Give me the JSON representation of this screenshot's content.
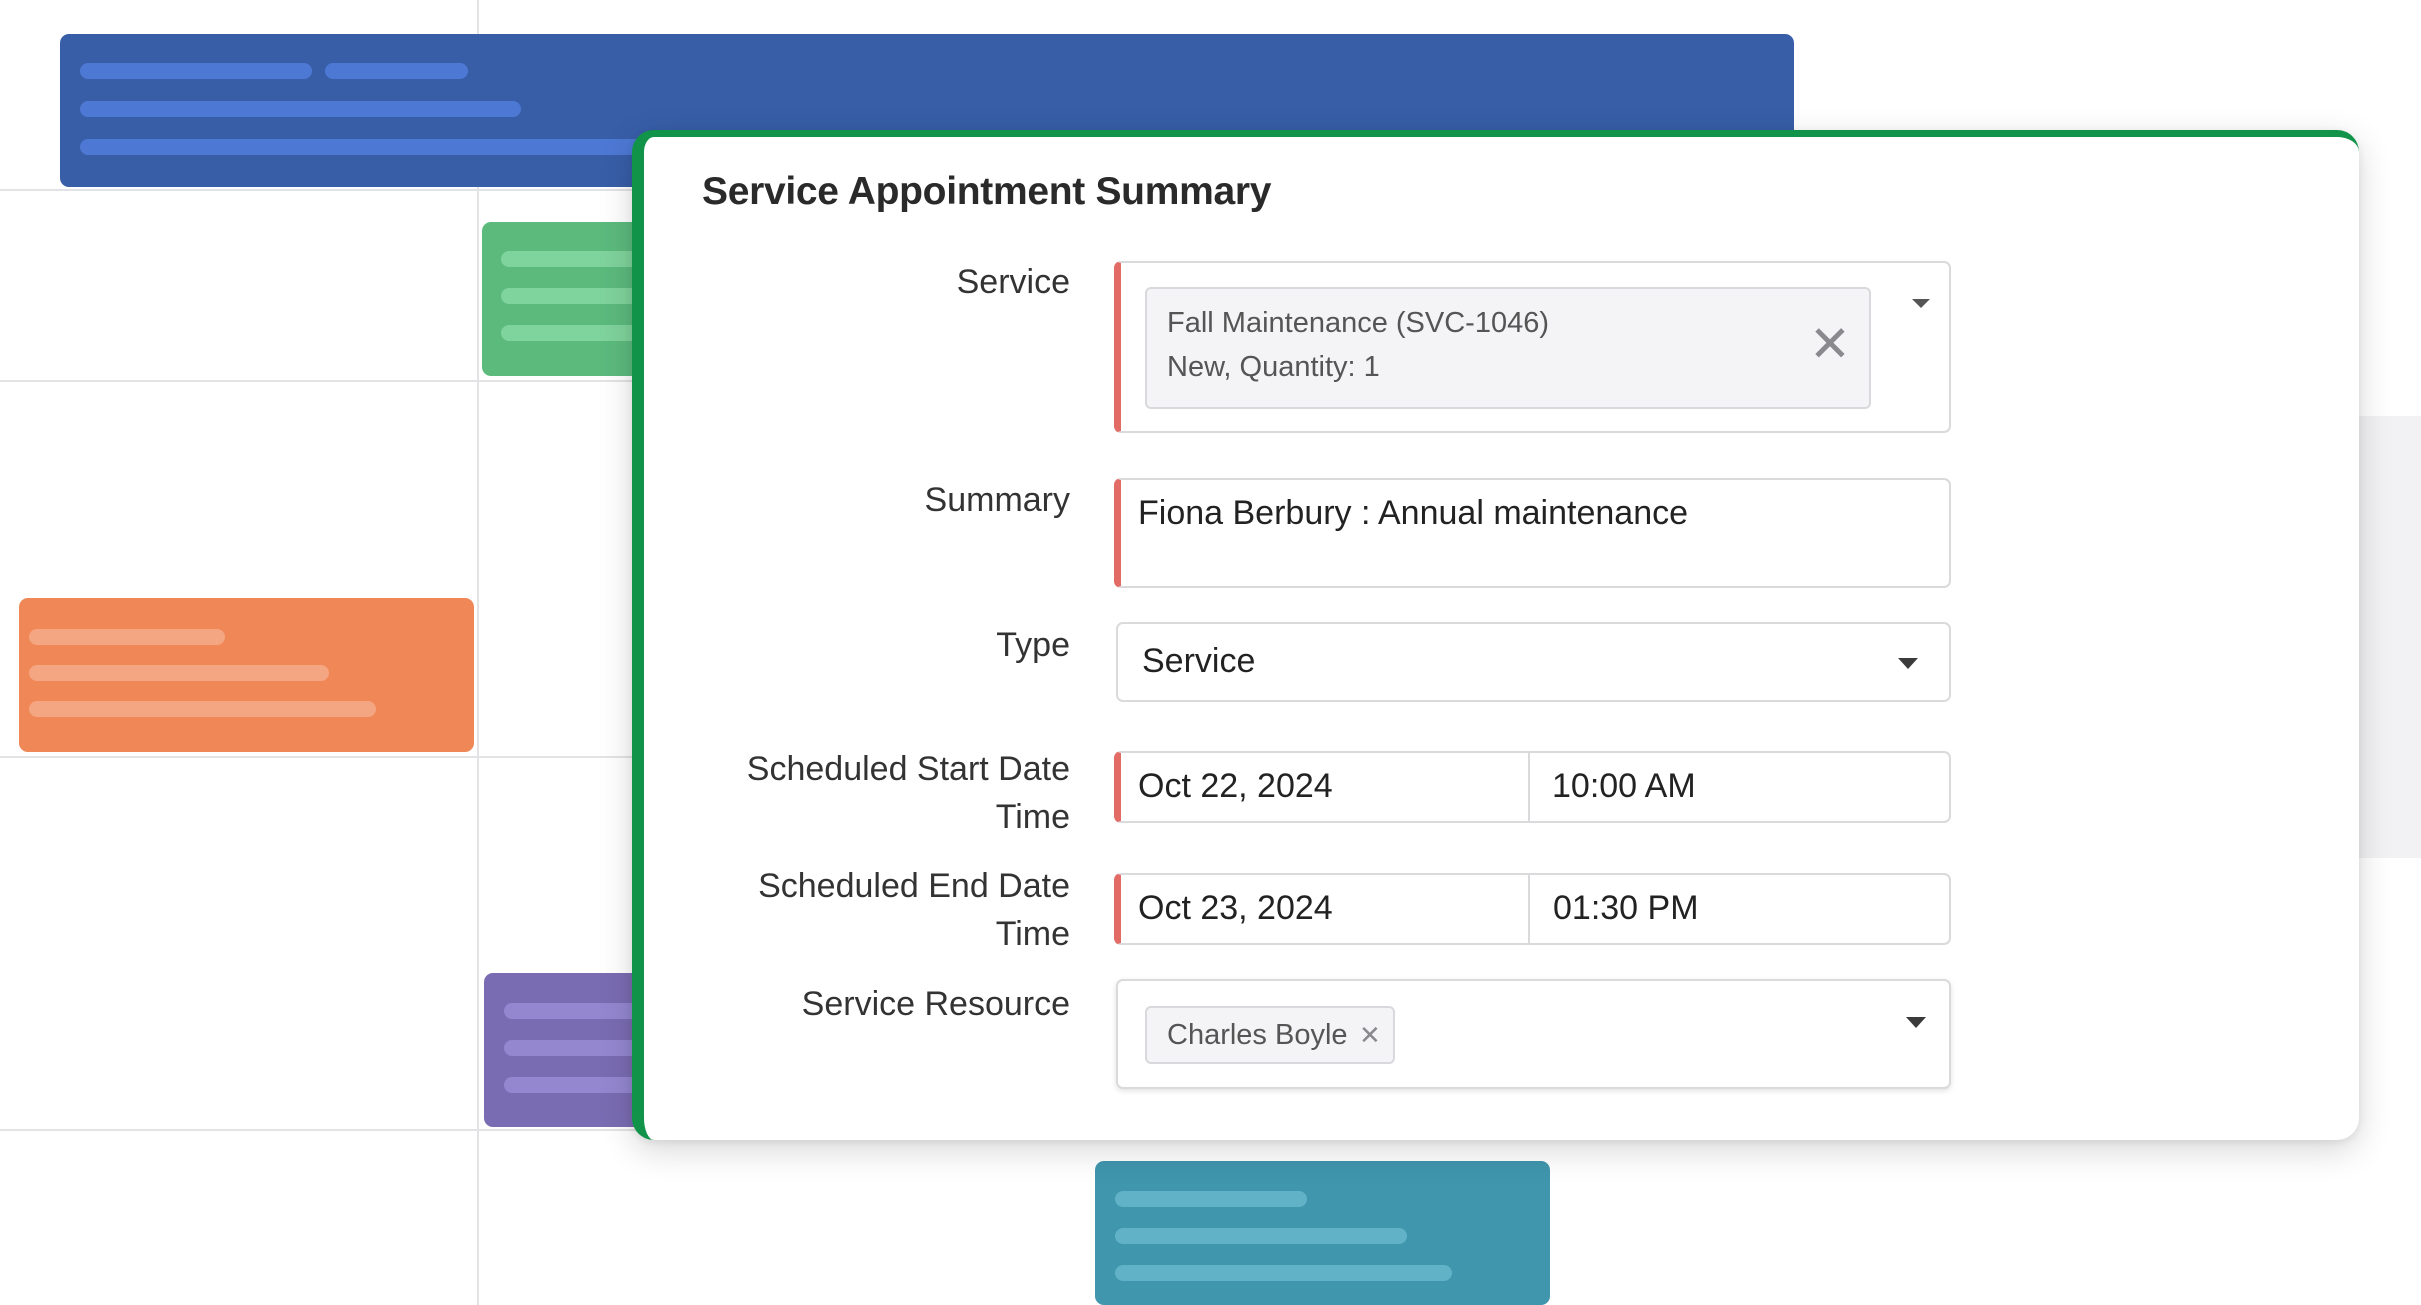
{
  "dialog": {
    "title": "Service Appointment Summary",
    "accent_color": "#11944a",
    "required_marker_color": "#e26b66"
  },
  "fields": {
    "service": {
      "label": "Service",
      "chip_line1": "Fall Maintenance (SVC-1046)",
      "chip_line2": "New, Quantity: 1",
      "remove_icon": "close-icon",
      "dropdown_icon": "chevron-down-icon"
    },
    "summary": {
      "label": "Summary",
      "value": "Fiona Berbury : Annual maintenance"
    },
    "type": {
      "label": "Type",
      "value": "Service",
      "dropdown_icon": "chevron-down-icon"
    },
    "scheduled_start": {
      "label_line1": "Scheduled Start Date",
      "label_line2": "Time",
      "date": "Oct 22, 2024",
      "time": "10:00 AM"
    },
    "scheduled_end": {
      "label_line1": "Scheduled End Date",
      "label_line2": "Time",
      "date": "Oct 23, 2024",
      "time": "01:30 PM"
    },
    "service_resource": {
      "label": "Service Resource",
      "chip": "Charles Boyle",
      "remove_icon": "close-icon",
      "dropdown_icon": "chevron-down-icon"
    }
  },
  "background_events": {
    "colors": {
      "blue": "#385ea8",
      "green": "#5cba7d",
      "orange": "#ef8757",
      "purple": "#7a6cb2",
      "teal": "#3f96ad"
    }
  }
}
